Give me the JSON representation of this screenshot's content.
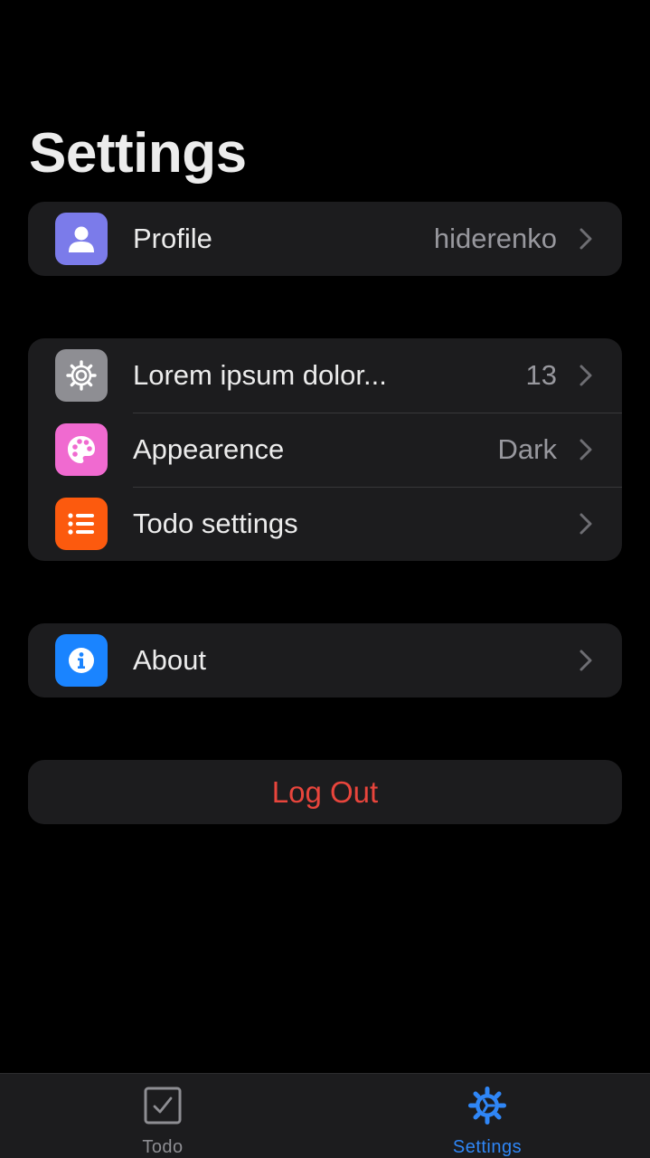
{
  "page": {
    "title": "Settings"
  },
  "profile_group": {
    "items": [
      {
        "label": "Profile",
        "value": "hiderenko",
        "icon": "person-icon",
        "color": "#7b7bea"
      }
    ]
  },
  "main_group": {
    "items": [
      {
        "label": "Lorem ipsum dolor...",
        "value": "13",
        "icon": "gear-icon",
        "color": "#8e8e93"
      },
      {
        "label": "Appearence",
        "value": "Dark",
        "icon": "palette-icon",
        "color": "#f06ad0"
      },
      {
        "label": "Todo settings",
        "value": "",
        "icon": "list-icon",
        "color": "#fc5a0e"
      }
    ]
  },
  "about_group": {
    "items": [
      {
        "label": "About",
        "value": "",
        "icon": "info-icon",
        "color": "#1a84ff"
      }
    ]
  },
  "logout": {
    "label": "Log Out",
    "color": "#e8453c"
  },
  "tabbar": {
    "tabs": [
      {
        "label": "Todo",
        "icon": "checkbox-icon",
        "active": false,
        "color": "#8e8e93"
      },
      {
        "label": "Settings",
        "icon": "gear-icon",
        "active": true,
        "color": "#2f86f6"
      }
    ]
  }
}
